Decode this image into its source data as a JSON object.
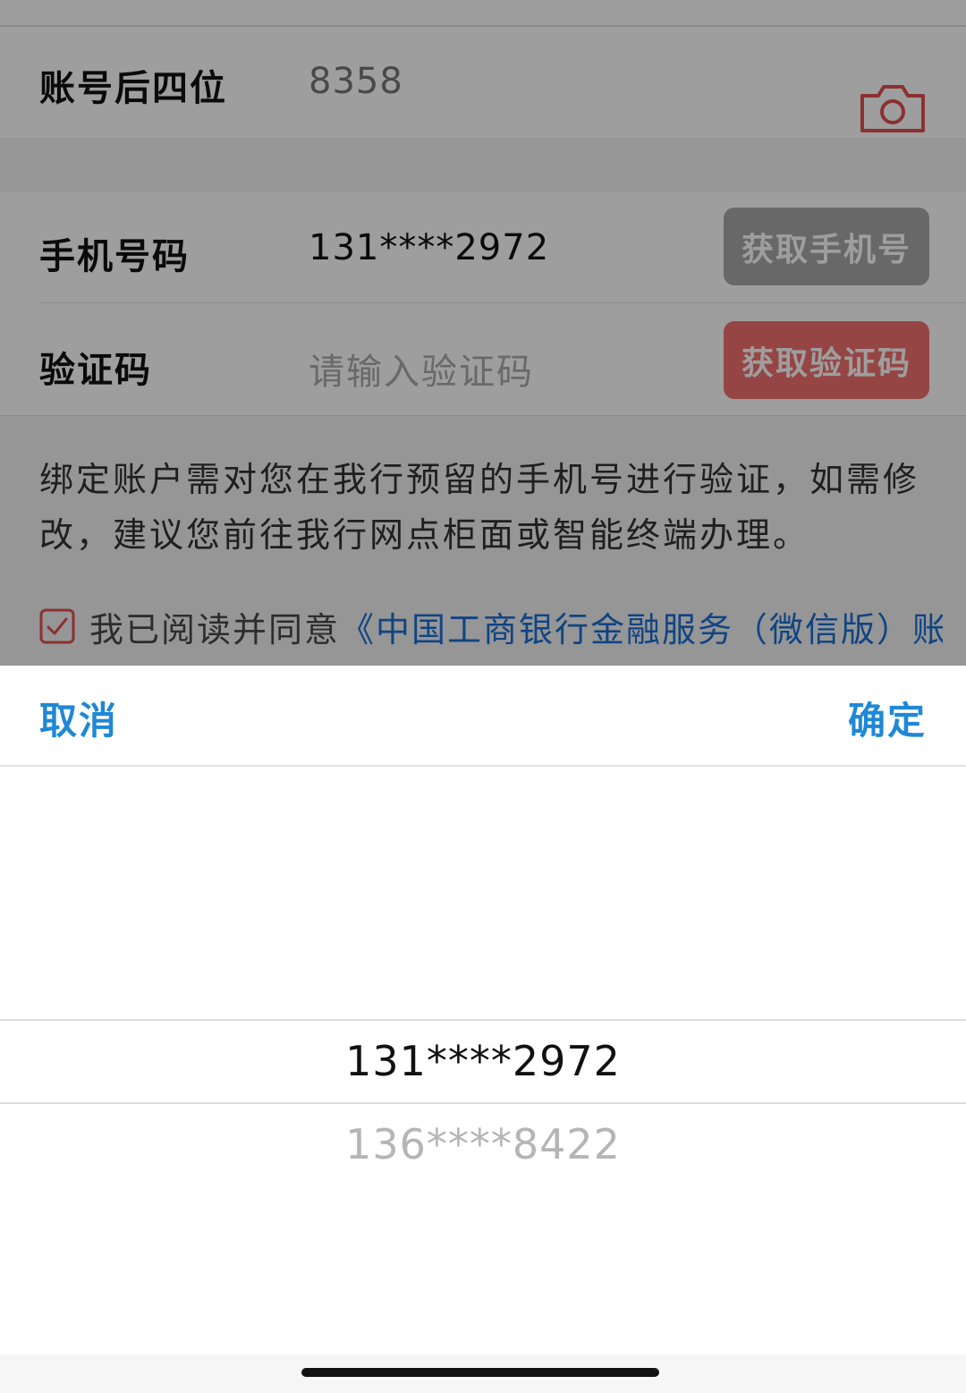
{
  "form": {
    "account_tail_label": "账号后四位",
    "account_tail_value": "8358",
    "phone_label": "手机号码",
    "phone_value": "131****2972",
    "get_phone_button": "获取手机号",
    "verification_label": "验证码",
    "verification_placeholder": "请输入验证码",
    "get_code_button": "获取验证码",
    "notice_text": "绑定账户需对您在我行预留的手机号进行验证，如需修改，建议您前往我行网点柜面或智能终端办理。",
    "agreement_prefix": "我已阅读并同意",
    "agreement_link": "《中国工商银行金融服务（微信版）账"
  },
  "picker": {
    "cancel_label": "取消",
    "confirm_label": "确定",
    "options": [
      "131****2972",
      "136****8422"
    ]
  },
  "colors": {
    "action_blue": "#1e88d6",
    "link_blue": "#1a6ed4",
    "danger_red": "#f0716e",
    "disabled_gray": "#a9a9a9"
  },
  "icons": [
    "camera-icon",
    "chevron-right-icon",
    "checkbox-checked-icon"
  ]
}
